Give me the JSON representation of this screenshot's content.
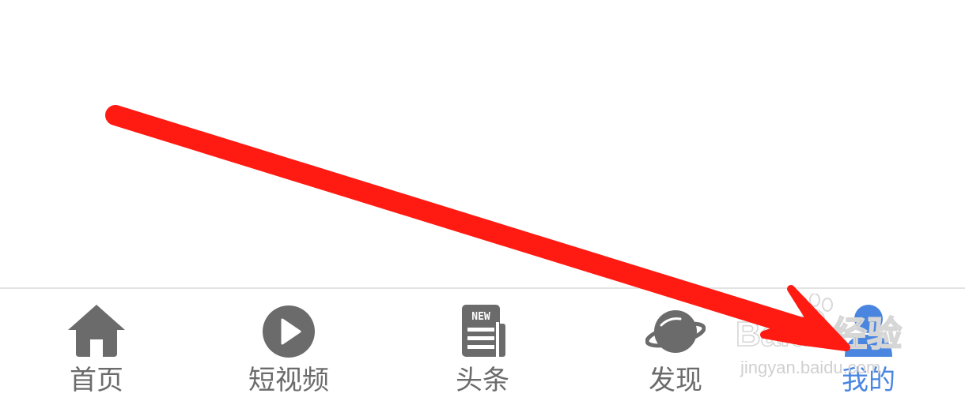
{
  "tabbar": {
    "tabs": [
      {
        "label": "首页",
        "icon": "home-icon"
      },
      {
        "label": "短视频",
        "icon": "play-circle-icon"
      },
      {
        "label": "头条",
        "icon": "newspaper-icon"
      },
      {
        "label": "发现",
        "icon": "planet-icon"
      },
      {
        "label": "我的",
        "icon": "user-icon",
        "active": true
      }
    ]
  },
  "watermark": {
    "brand": "Baidu经验",
    "url": "jingyan.baidu.com"
  },
  "colors": {
    "icon_inactive": "#6b6b6b",
    "active": "#4a86e0",
    "annotation_arrow": "#ff1a12"
  }
}
